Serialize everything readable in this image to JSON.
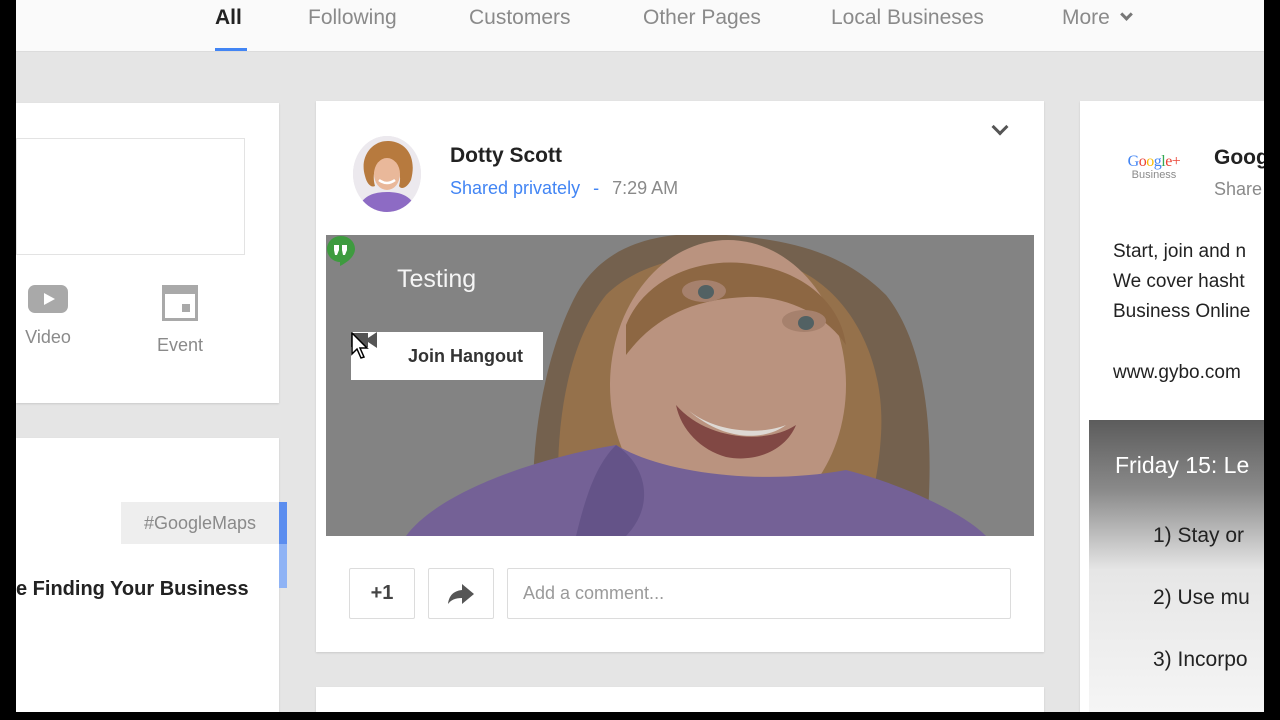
{
  "nav": {
    "tabs": [
      "All",
      "Following",
      "Customers",
      "Other Pages",
      "Local Busineses",
      "More"
    ],
    "active_tab": "All"
  },
  "left": {
    "share_actions": {
      "video": "Video",
      "event": "Event"
    },
    "hashtag": "#GoogleMaps",
    "post_title": "e Finding Your Business"
  },
  "post": {
    "author": "Dotty Scott",
    "visibility": "Shared privately",
    "separator": "-",
    "time": "7:29 AM",
    "hangout": {
      "title": "Testing",
      "join_label": "Join Hangout"
    },
    "actions": {
      "plus_one_label": "+1",
      "comment_placeholder": "Add a comment..."
    }
  },
  "right": {
    "logo_line1": "Google+",
    "logo_line2": "Business",
    "author": "Goog",
    "shared": "Share",
    "text_lines": [
      "Start, join and n",
      "We cover hasht",
      "Business Online"
    ],
    "url": "www.gybo.com",
    "banner": {
      "title": "Friday 15: Le",
      "items": [
        "1)  Stay or",
        "2)  Use mu",
        "3)  Incorpo"
      ]
    }
  },
  "colors": {
    "accent": "#4285f4",
    "hangouts_green": "#3e9b3f",
    "background": "#e5e5e5"
  }
}
